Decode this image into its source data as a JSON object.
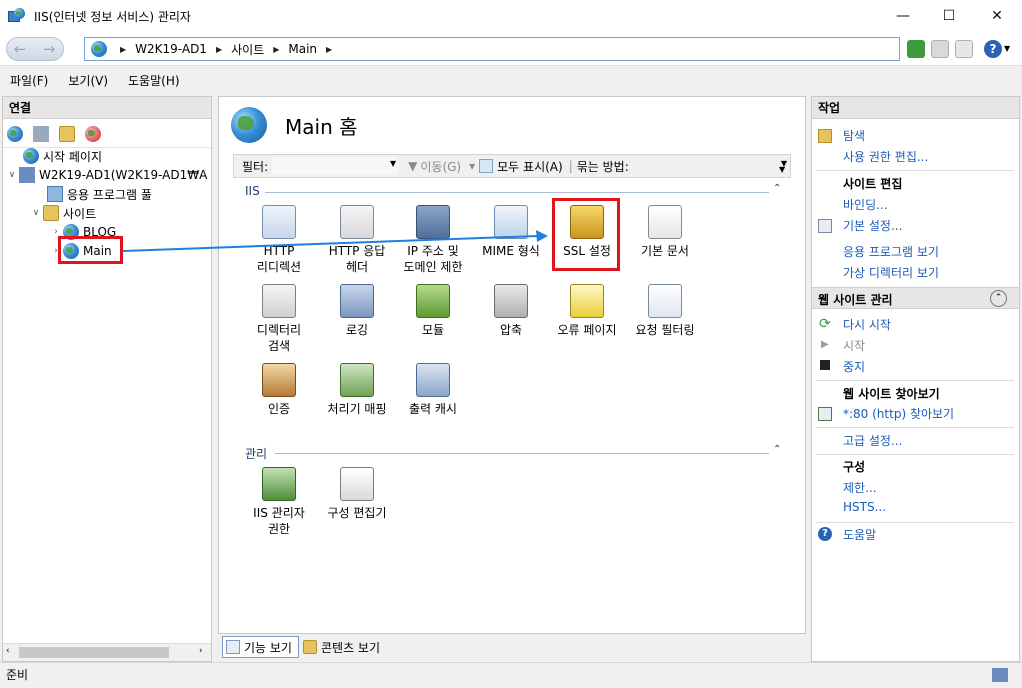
{
  "window": {
    "title": "IIS(인터넷 정보 서비스) 관리자",
    "minimize": "—",
    "maximize": "☐",
    "close": "✕"
  },
  "address": {
    "crumbs": [
      "W2K19-AD1",
      "사이트",
      "Main"
    ]
  },
  "menu": [
    "파일(F)",
    "보기(V)",
    "도움말(H)"
  ],
  "connections": {
    "title": "연결",
    "tree": {
      "start_page": "시작 페이지",
      "server": "W2K19-AD1(W2K19-AD1₩A",
      "app_pools": "응용 프로그램 풀",
      "sites": "사이트",
      "blog": "BLOG",
      "main": "Main"
    }
  },
  "main": {
    "title": "Main 홈",
    "filter_label": "필터:",
    "go_label": "이동(G)",
    "show_all": "모두 표시(A)",
    "group_by": "묶는 방법:",
    "group_iis": "IIS",
    "group_mgmt": "관리",
    "features_iis": [
      [
        "HTTP",
        "리디렉션"
      ],
      [
        "HTTP 응답",
        "헤더"
      ],
      [
        "IP 주소 및",
        "도메인 제한"
      ],
      [
        "MIME 형식"
      ],
      [
        "SSL 설정"
      ],
      [
        "기본 문서"
      ],
      [
        "디렉터리",
        "검색"
      ],
      [
        "로깅"
      ],
      [
        "모듈"
      ],
      [
        "압축"
      ],
      [
        "오류 페이지"
      ],
      [
        "요청 필터링"
      ],
      [
        "인증"
      ],
      [
        "처리기 매핑"
      ],
      [
        "출력 캐시"
      ]
    ],
    "features_mgmt": [
      [
        "IIS 관리자",
        "권한"
      ],
      [
        "구성 편집기"
      ]
    ],
    "view_features": "기능 보기",
    "view_content": "콘텐츠 보기"
  },
  "actions": {
    "title": "작업",
    "explore": "탐색",
    "edit_perms": "사용 권한 편집...",
    "site_edit_h": "사이트 편집",
    "bindings": "바인딩...",
    "basic_settings": "기본 설정...",
    "view_apps": "응용 프로그램 보기",
    "view_vdirs": "가상 디렉터리 보기",
    "manage_h": "웹 사이트 관리",
    "restart": "다시 시작",
    "start": "시작",
    "stop": "중지",
    "browse_h": "웹 사이트 찾아보기",
    "browse_80": "*:80 (http) 찾아보기",
    "advanced": "고급 설정...",
    "config_h": "구성",
    "limits": "제한...",
    "hsts": "HSTS...",
    "help": "도움말"
  },
  "status": {
    "text": "준비"
  },
  "colors": {
    "link": "#1c5bb6",
    "highlight": "#e0141c",
    "arrow": "#1f7fe0"
  }
}
